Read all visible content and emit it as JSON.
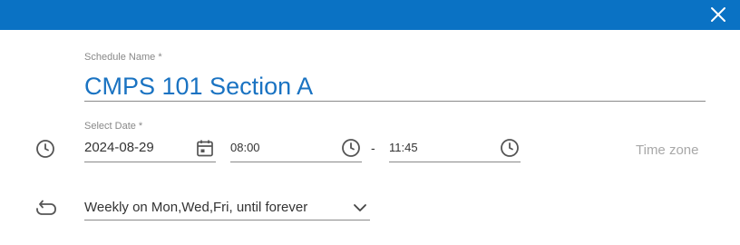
{
  "dialog": {
    "close_icon": "close-icon"
  },
  "schedule_name": {
    "label": "Schedule Name *",
    "value": "CMPS 101 Section A"
  },
  "date_row": {
    "label": "Select Date *",
    "date": "2024-08-29",
    "start_time": "08:00",
    "separator": "-",
    "end_time": "11:45",
    "timezone_placeholder": "Time zone",
    "icons": [
      "clock-icon",
      "calendar-icon",
      "clock-icon",
      "clock-icon"
    ]
  },
  "repeat": {
    "selected": "Weekly on Mon,Wed,Fri, until forever",
    "icon": "repeat-icon",
    "chevron": "chevron-down-icon"
  },
  "colors": {
    "header": "#0a72c4",
    "accent_text": "#1a73c2"
  }
}
